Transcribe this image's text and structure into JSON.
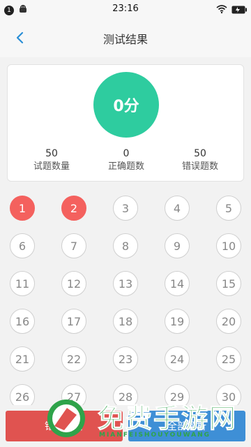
{
  "status_bar": {
    "badge": "1",
    "time": "23:16"
  },
  "nav": {
    "title": "测试结果"
  },
  "summary": {
    "score": "0分",
    "stats": [
      {
        "value": "50",
        "label": "试题数量"
      },
      {
        "value": "0",
        "label": "正确题数"
      },
      {
        "value": "50",
        "label": "错误题数"
      }
    ]
  },
  "questions": [
    {
      "n": "1",
      "state": "wrong"
    },
    {
      "n": "2",
      "state": "wrong"
    },
    {
      "n": "3",
      "state": "normal"
    },
    {
      "n": "4",
      "state": "normal"
    },
    {
      "n": "5",
      "state": "normal"
    },
    {
      "n": "6",
      "state": "normal"
    },
    {
      "n": "7",
      "state": "normal"
    },
    {
      "n": "8",
      "state": "normal"
    },
    {
      "n": "9",
      "state": "normal"
    },
    {
      "n": "10",
      "state": "normal"
    },
    {
      "n": "11",
      "state": "normal"
    },
    {
      "n": "12",
      "state": "normal"
    },
    {
      "n": "13",
      "state": "normal"
    },
    {
      "n": "14",
      "state": "normal"
    },
    {
      "n": "15",
      "state": "normal"
    },
    {
      "n": "16",
      "state": "normal"
    },
    {
      "n": "17",
      "state": "normal"
    },
    {
      "n": "18",
      "state": "normal"
    },
    {
      "n": "19",
      "state": "normal"
    },
    {
      "n": "20",
      "state": "normal"
    },
    {
      "n": "21",
      "state": "normal"
    },
    {
      "n": "22",
      "state": "normal"
    },
    {
      "n": "23",
      "state": "normal"
    },
    {
      "n": "24",
      "state": "normal"
    },
    {
      "n": "25",
      "state": "normal"
    },
    {
      "n": "26",
      "state": "normal"
    },
    {
      "n": "27",
      "state": "normal"
    },
    {
      "n": "28",
      "state": "normal"
    },
    {
      "n": "29",
      "state": "normal"
    },
    {
      "n": "30",
      "state": "normal"
    }
  ],
  "buttons": {
    "left_label": "错题解析",
    "right_label": "全部解析"
  },
  "watermark": {
    "big": "免费手游网",
    "small": "MIANFEISHOUYOUWANG"
  },
  "colors": {
    "score_green": "#2ecc9f",
    "wrong_red": "#f4615e",
    "nav_blue": "#2b8fd6"
  }
}
